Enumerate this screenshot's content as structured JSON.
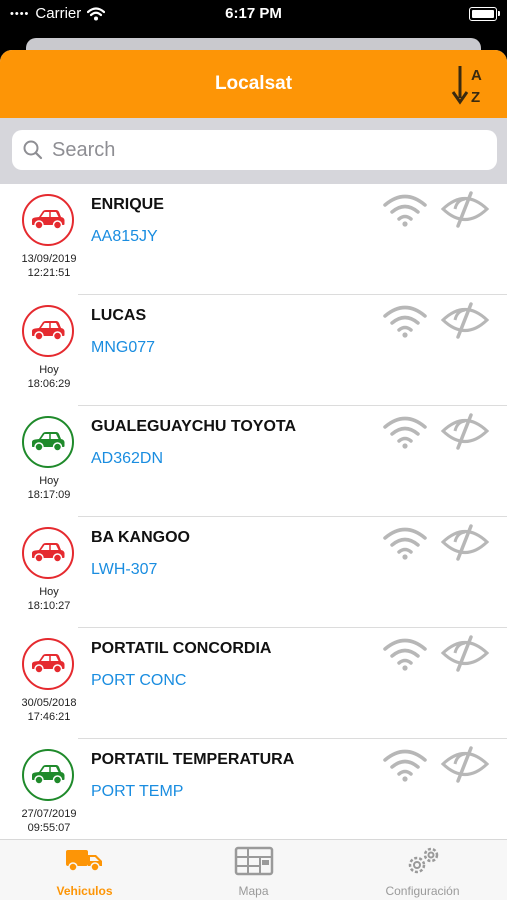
{
  "status_bar": {
    "carrier": "Carrier",
    "time": "6:17 PM"
  },
  "header": {
    "title": "Localsat",
    "sort_icon": "sort-az-icon"
  },
  "search": {
    "placeholder": "Search"
  },
  "colors": {
    "accent": "#fd9506",
    "red": "#e52a2f",
    "green": "#1f8a2b",
    "plate": "#1a8de0",
    "muted": "#b7b7b7"
  },
  "vehicles": [
    {
      "name": "ENRIQUE",
      "plate": "AA815JY",
      "date": "13/09/2019",
      "time": "12:21:51",
      "status": "red"
    },
    {
      "name": "LUCAS",
      "plate": "MNG077",
      "date": "Hoy",
      "time": "18:06:29",
      "status": "red"
    },
    {
      "name": "GUALEGUAYCHU TOYOTA",
      "plate": "AD362DN",
      "date": "Hoy",
      "time": "18:17:09",
      "status": "green"
    },
    {
      "name": "BA KANGOO",
      "plate": "LWH-307",
      "date": "Hoy",
      "time": "18:10:27",
      "status": "red"
    },
    {
      "name": "PORTATIL CONCORDIA",
      "plate": "PORT CONC",
      "date": "30/05/2018",
      "time": "17:46:21",
      "status": "red"
    },
    {
      "name": "PORTATIL TEMPERATURA",
      "plate": "PORT TEMP",
      "date": "27/07/2019",
      "time": "09:55:07",
      "status": "green"
    }
  ],
  "tabs": [
    {
      "label": "Vehiculos",
      "icon": "truck-icon",
      "active": true
    },
    {
      "label": "Mapa",
      "icon": "map-icon",
      "active": false
    },
    {
      "label": "Configuración",
      "icon": "gears-icon",
      "active": false
    }
  ]
}
